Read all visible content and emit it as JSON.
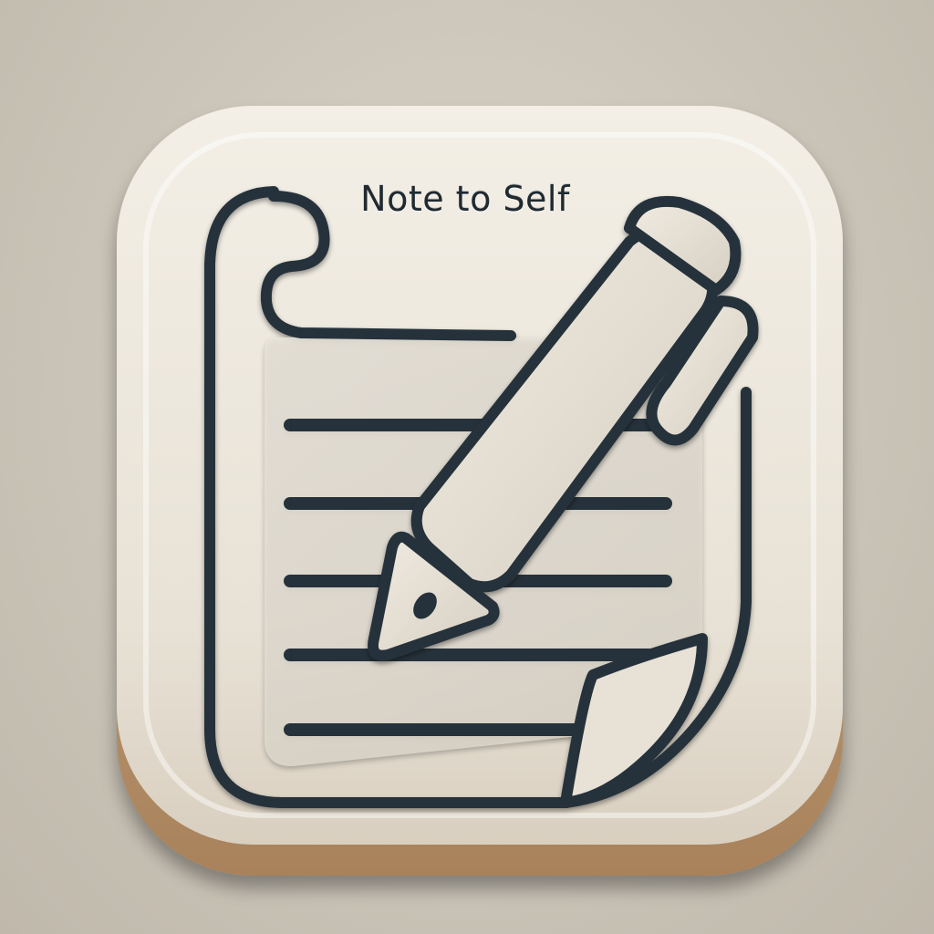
{
  "icon": {
    "name": "note-to-self-app-icon",
    "caption": "Note to Self",
    "glyph": "notepad-with-pen-icon"
  },
  "colors": {
    "background": "#cbc5b9",
    "tile": "#ece7dd",
    "tile_shadow": "#a88a66",
    "stroke": "#26333a",
    "paper": "#e5e0d5"
  }
}
